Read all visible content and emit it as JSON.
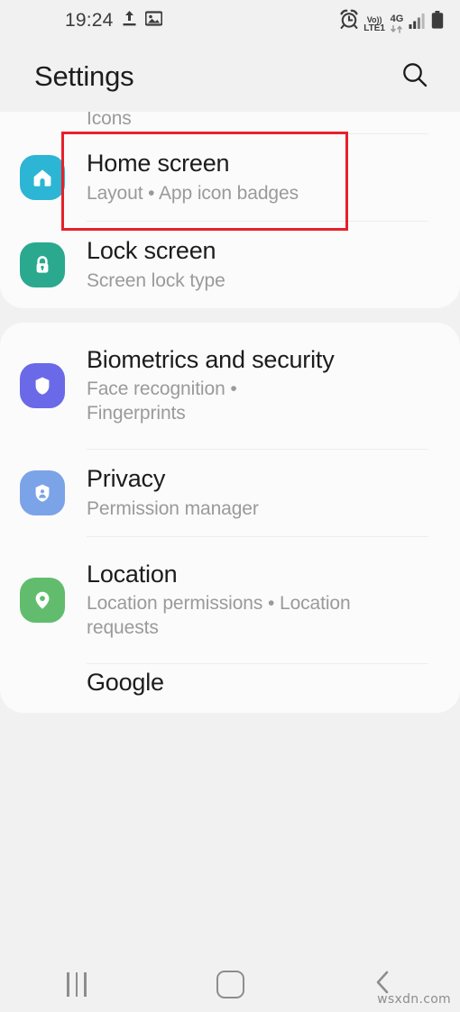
{
  "status_bar": {
    "time": "19:24",
    "icons_left": [
      "upload-icon",
      "image-icon"
    ],
    "volte_top": "Vo))",
    "volte_bottom": "LTE1",
    "network_label": "4G",
    "icons_right": [
      "alarm-icon",
      "volte-icon",
      "4g-data-icon",
      "signal-bars-icon",
      "battery-icon"
    ]
  },
  "header": {
    "title": "Settings",
    "search_icon": "search-icon"
  },
  "cards": [
    {
      "id": "card-display",
      "rows": [
        {
          "id": "row-icons-clipped",
          "title": "Icons",
          "subtitle": "",
          "icon": "",
          "icon_color": "",
          "clipped": "top"
        },
        {
          "id": "row-home-screen",
          "title": "Home screen",
          "subtitle": "Layout  •  App icon badges",
          "icon": "home-icon",
          "icon_color": "#2cb5d4"
        },
        {
          "id": "row-lock-screen",
          "title": "Lock screen",
          "subtitle": "Screen lock type",
          "icon": "lock-icon",
          "icon_color": "#2aa98f"
        }
      ]
    },
    {
      "id": "card-security",
      "rows": [
        {
          "id": "row-biometrics-and-security",
          "title": "Biometrics and security",
          "subtitle": "Face recognition  •  Fingerprints",
          "icon": "shield-icon",
          "icon_color": "#6a6ae8",
          "highlighted": true
        },
        {
          "id": "row-privacy",
          "title": "Privacy",
          "subtitle": "Permission manager",
          "icon": "shield-person-icon",
          "icon_color": "#7ba3e8"
        },
        {
          "id": "row-location",
          "title": "Location",
          "subtitle": "Location permissions  •  Location requests",
          "icon": "location-pin-icon",
          "icon_color": "#61bd6d"
        },
        {
          "id": "row-google-clipped",
          "title": "Google",
          "subtitle": "",
          "icon": "",
          "icon_color": "",
          "clipped": "bottom"
        }
      ]
    }
  ],
  "annotation": {
    "color": "#e8202a",
    "target": "Biometrics and security"
  },
  "nav_bar": {
    "recents_icon": "recents-icon",
    "home_icon": "home-square-icon",
    "back_icon": "back-chevron-icon"
  },
  "watermark": {
    "text": "wsxdn.com"
  }
}
